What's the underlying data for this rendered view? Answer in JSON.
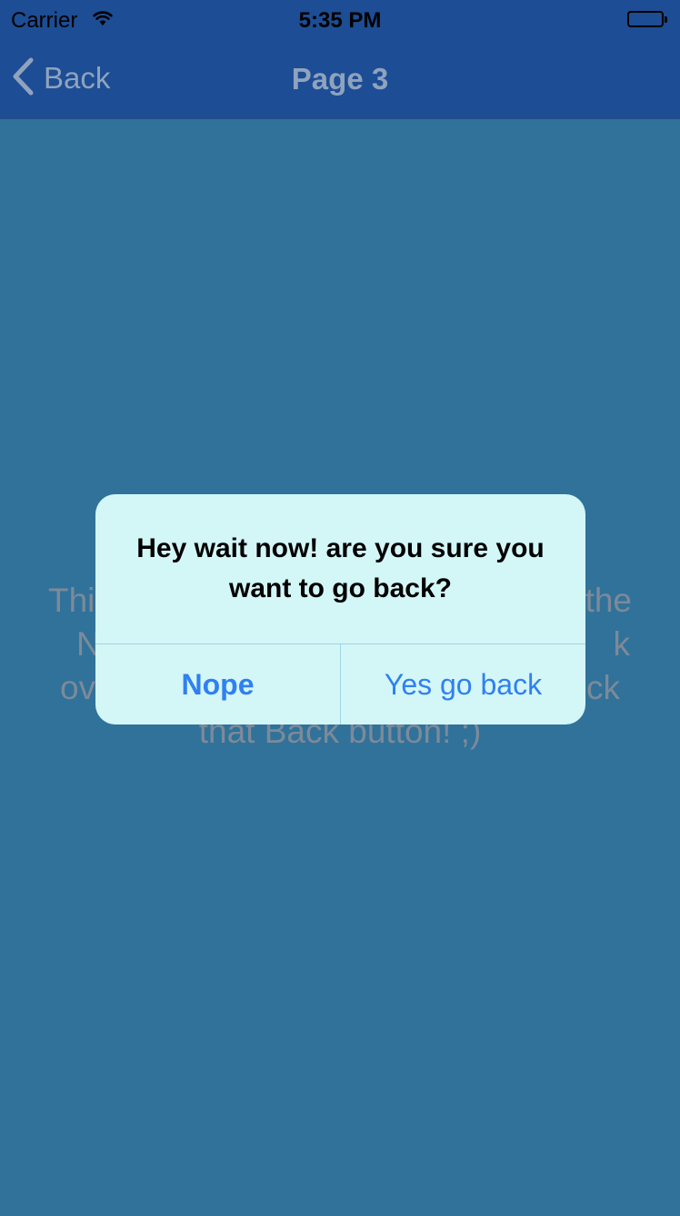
{
  "status_bar": {
    "carrier": "Carrier",
    "time": "5:35 PM",
    "icons": [
      "wifi-icon",
      "battery-icon"
    ]
  },
  "nav_bar": {
    "back_label": "Back",
    "title": "Page 3",
    "icons": [
      "chevron-left-icon"
    ]
  },
  "content": {
    "body_lines": [
      "Thi",
      "the",
      "N",
      "k",
      "ov",
      "ck",
      "that Back button! ;)"
    ]
  },
  "alert": {
    "message": "Hey wait now! are you sure you want to go back?",
    "cancel_label": "Nope",
    "confirm_label": "Yes go back"
  },
  "colors": {
    "background": "#30729a",
    "bar": "#1d4d94",
    "alert_background": "#d3f6f7",
    "alert_button": "#2f80f0"
  }
}
